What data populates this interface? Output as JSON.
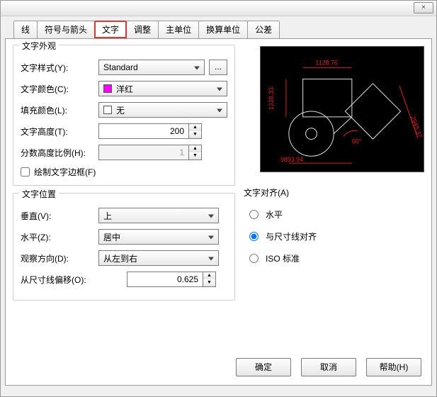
{
  "window": {
    "close_label": "×"
  },
  "tabs": {
    "line": "线",
    "symbols_arrows": "符号与箭头",
    "text": "文字",
    "adjust": "调整",
    "primary_units": "主单位",
    "alt_units": "换算单位",
    "tolerance": "公差"
  },
  "appearance": {
    "legend": "文字外观",
    "style_label": "文字样式(Y):",
    "style_value": "Standard",
    "dots": "...",
    "color_label": "文字颜色(C):",
    "color_value": "洋红",
    "fill_label": "填充颜色(L):",
    "fill_value": "无",
    "height_label": "文字高度(T):",
    "height_value": "200",
    "frac_label": "分数高度比例(H):",
    "frac_value": "1",
    "frame_label": "绘制文字边框(F)"
  },
  "position": {
    "legend": "文字位置",
    "vert_label": "垂直(V):",
    "vert_value": "上",
    "horz_label": "水平(Z):",
    "horz_value": "居中",
    "view_label": "观察方向(D):",
    "view_value": "从左到右",
    "offset_label": "从尺寸线偏移(O):",
    "offset_value": "0.625"
  },
  "alignment": {
    "legend": "文字对齐(A)",
    "horizontal": "水平",
    "with_dim": "与尺寸线对齐",
    "iso": "ISO 标准"
  },
  "preview": {
    "dim_top": "1128.76",
    "dim_left": "1328.33",
    "dim_bottom": "9893.94",
    "dim_right": "2945.37",
    "angle": "60°"
  },
  "buttons": {
    "ok": "确定",
    "cancel": "取消",
    "help": "帮助(H)"
  }
}
